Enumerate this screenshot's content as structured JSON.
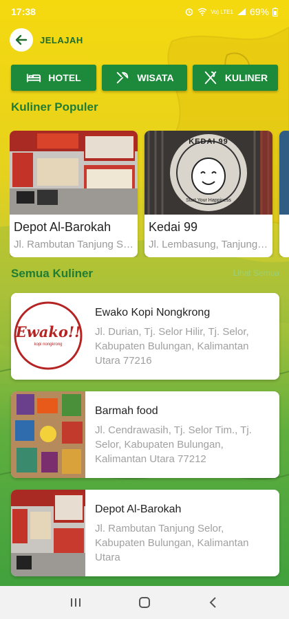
{
  "status": {
    "time": "17:38",
    "battery": "69%",
    "network": "Vo) LTE1"
  },
  "header": {
    "title": "JELAJAH"
  },
  "categories": [
    {
      "label": "HOTEL",
      "icon": "bed-icon"
    },
    {
      "label": "WISATA",
      "icon": "compass-icon"
    },
    {
      "label": "KULINER",
      "icon": "utensils-icon"
    }
  ],
  "popular": {
    "title": "Kuliner Populer",
    "items": [
      {
        "name": "Depot Al-Barokah",
        "address": "Jl. Rambutan Tanjung Selor"
      },
      {
        "name": "Kedai 99",
        "address": "Jl. Lembasung, Tanjung Selor",
        "logo_text": "KEDAI 99",
        "logo_sub": "Start Your Happiness"
      }
    ]
  },
  "all": {
    "title": "Semua Kuliner",
    "see_all": "Lihat Semua",
    "items": [
      {
        "name": "Ewako Kopi Nongkrong",
        "address": "Jl. Durian, Tj. Selor Hilir, Tj. Selor, Kabupaten Bulungan, Kalimantan Utara 77216",
        "logo_text": "Ewako!!",
        "logo_sub": "kopi nongkrong"
      },
      {
        "name": "Barmah food",
        "address": "Jl. Cendrawasih, Tj. Selor Tim., Tj. Selor, Kabupaten Bulungan, Kalimantan Utara 77212"
      },
      {
        "name": "Depot Al-Barokah",
        "address": "Jl. Rambutan Tanjung Selor, Kabupaten Bulungan, Kalimantan Utara"
      }
    ]
  },
  "colors": {
    "accent": "#1d8a3b",
    "title": "#1f7c35",
    "yellow": "#f5d90f"
  }
}
